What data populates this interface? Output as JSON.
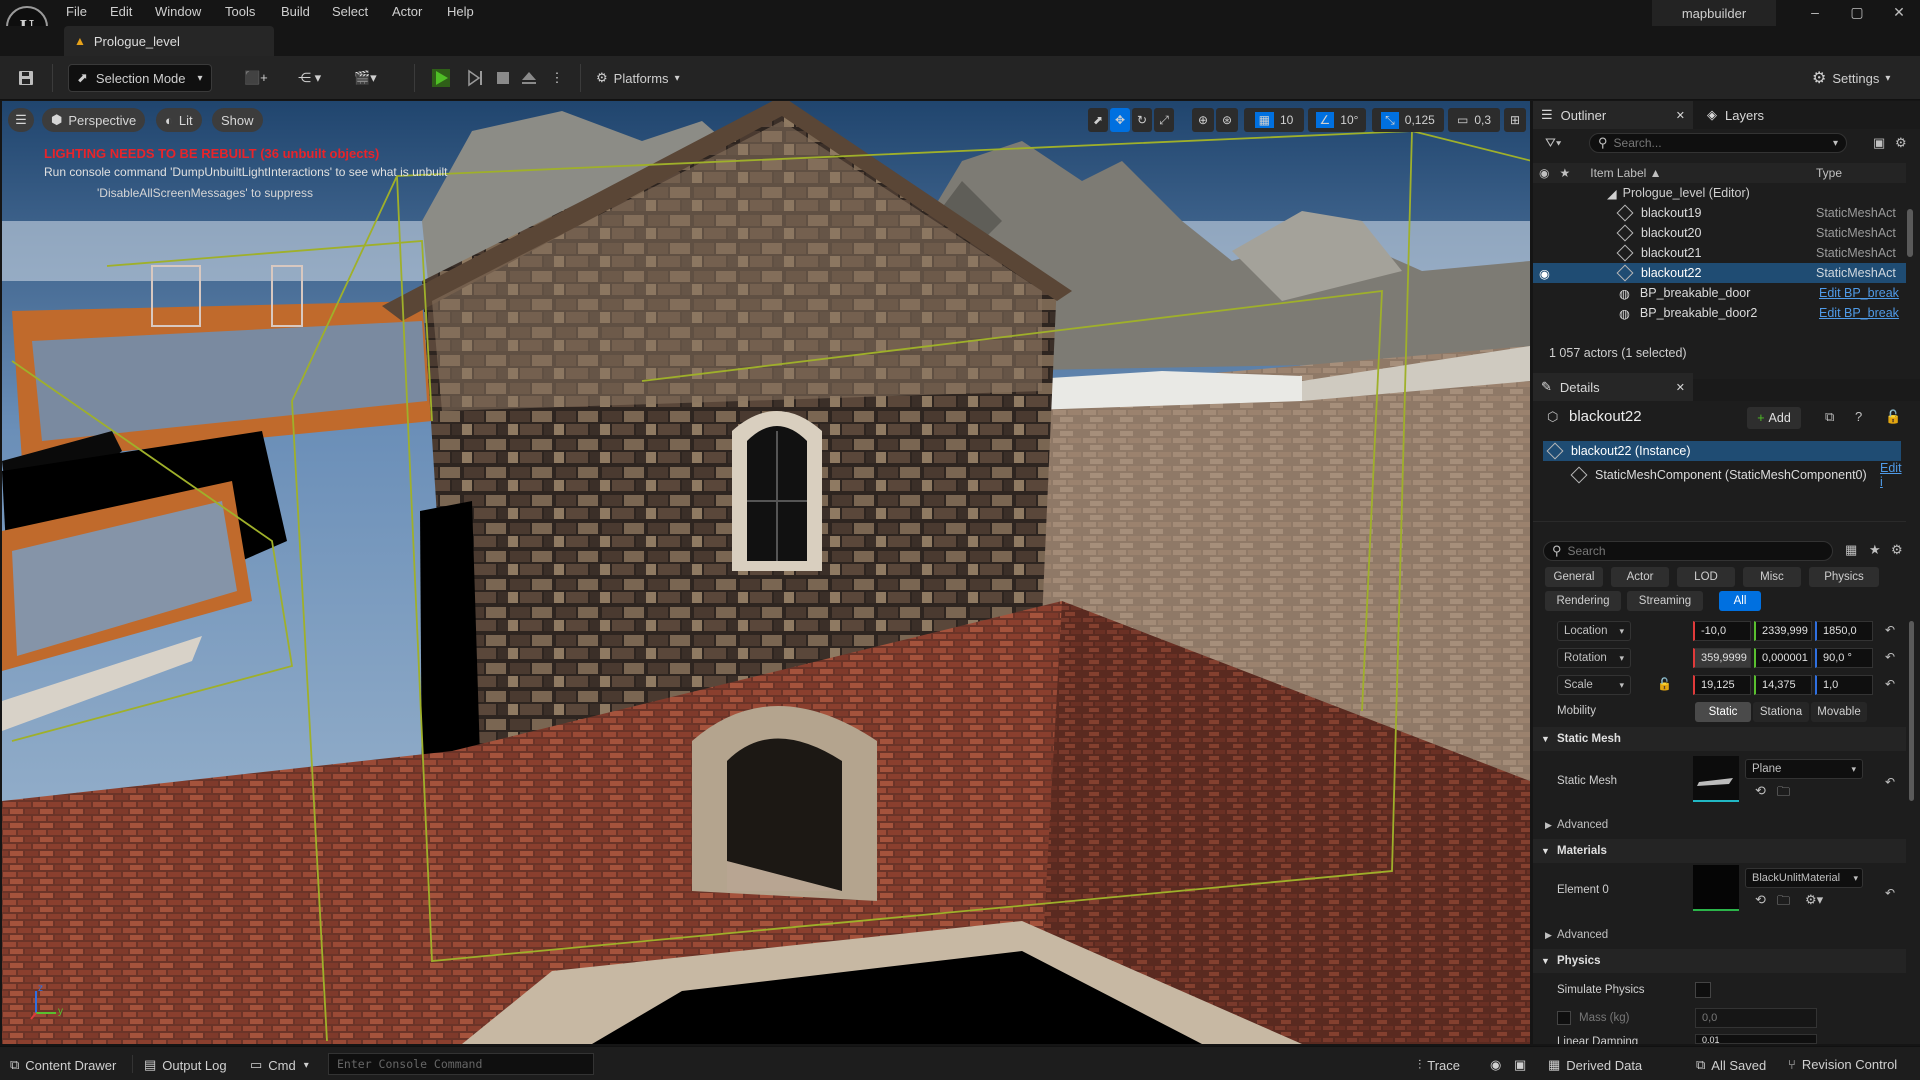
{
  "app": {
    "logo": "U",
    "project_name": "mapbuilder",
    "minimize": "–",
    "maximize": "▢",
    "close": "✕"
  },
  "menu": [
    "File",
    "Edit",
    "Window",
    "Tools",
    "Build",
    "Select",
    "Actor",
    "Help"
  ],
  "tab": {
    "warn_icon": "▲",
    "label": "Prologue_level"
  },
  "toolbar": {
    "selection_mode": "Selection Mode",
    "platforms": "Platforms",
    "settings": "Settings"
  },
  "viewport": {
    "perspective": "Perspective",
    "lit": "Lit",
    "show": "Show",
    "grid_snap": "10",
    "rotation_snap": "10°",
    "scale_snap": "0,125",
    "camera_speed": "0,3",
    "warning_title": "LIGHTING NEEDS TO BE REBUILT (36 unbuilt objects)",
    "warning_hint": "Run console command 'DumpUnbuiltLightInteractions' to see what is unbuilt",
    "warning_suppress": "'DisableAllScreenMessages' to suppress",
    "axis_z": "z",
    "axis_y": "y",
    "axis_x": "x"
  },
  "outliner": {
    "tab_label": "Outliner",
    "layers_label": "Layers",
    "search_placeholder": "Search...",
    "col_label": "Item Label ▲",
    "col_type": "Type",
    "root": "Prologue_level (Editor)",
    "items": [
      {
        "label": "blackout19",
        "type": "StaticMeshAct"
      },
      {
        "label": "blackout20",
        "type": "StaticMeshAct"
      },
      {
        "label": "blackout21",
        "type": "StaticMeshAct"
      },
      {
        "label": "blackout22",
        "type": "StaticMeshAct"
      },
      {
        "label": "BP_breakable_door",
        "type": "Edit BP_break"
      },
      {
        "label": "BP_breakable_door2",
        "type": "Edit BP_break"
      }
    ],
    "summary": "1 057 actors (1 selected)"
  },
  "details": {
    "tab_label": "Details",
    "actor_name": "blackout22",
    "add_label": "Add",
    "instance": "blackout22 (Instance)",
    "component": "StaticMeshComponent (StaticMeshComponent0)",
    "component_edit": "Edit i",
    "search_placeholder": "Search",
    "categories_row1": [
      "General",
      "Actor",
      "LOD",
      "Misc",
      "Physics"
    ],
    "categories_row2": [
      "Rendering",
      "Streaming",
      "All"
    ],
    "location_label": "Location",
    "location": [
      "-10,0",
      "2339,999",
      "1850,0"
    ],
    "rotation_label": "Rotation",
    "rotation": [
      "359,9999",
      "0,000001",
      "90,0 °"
    ],
    "scale_label": "Scale",
    "scale": [
      "19,125",
      "14,375",
      "1,0"
    ],
    "mobility_label": "Mobility",
    "mobility_options": [
      "Static",
      "Stationa",
      "Movable"
    ],
    "static_mesh_section": "Static Mesh",
    "static_mesh_label": "Static Mesh",
    "static_mesh_value": "Plane",
    "advanced1": "Advanced",
    "materials_section": "Materials",
    "element0_label": "Element 0",
    "element0_value": "BlackUnlitMaterial",
    "advanced2": "Advanced",
    "physics_section": "Physics",
    "simulate_label": "Simulate Physics",
    "mass_label": "Mass (kg)",
    "mass_value": "0,0",
    "linear_damping_label": "Linear Damping",
    "linear_damping_value": "0,01"
  },
  "statusbar": {
    "content_drawer": "Content Drawer",
    "output_log": "Output Log",
    "cmd": "Cmd",
    "console_placeholder": "Enter Console Command",
    "trace": "Trace",
    "derived_data": "Derived Data",
    "all_saved": "All Saved",
    "revision_control": "Revision Control"
  },
  "colors": {
    "accent": "#0070e0",
    "selected_row": "#1f4c73",
    "play_green": "#4fbf26",
    "warning_red": "#e8242a"
  }
}
